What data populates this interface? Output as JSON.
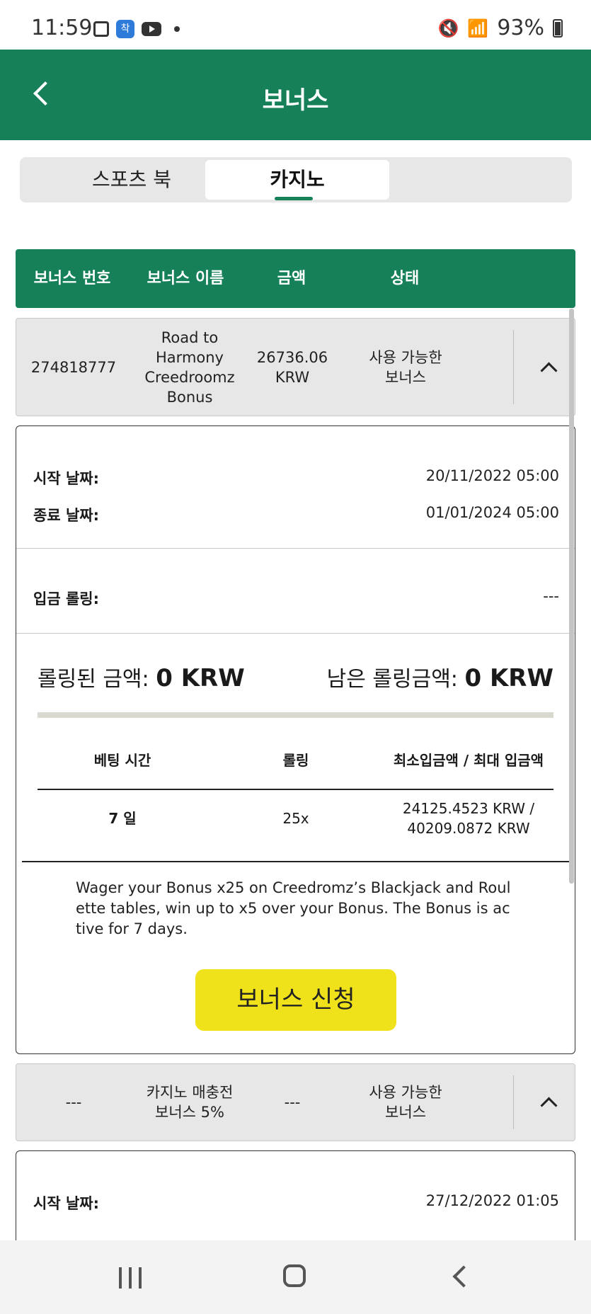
{
  "status_bar": {
    "time": "11:59",
    "notif_badge": "착",
    "battery_pct": "93%"
  },
  "header": {
    "title": "보너스"
  },
  "tabs": [
    {
      "label": "스포츠 북",
      "active": false
    },
    {
      "label": "카지노",
      "active": true
    }
  ],
  "table_headers": {
    "id": "보너스 번호",
    "name": "보너스 이름",
    "amount": "금액",
    "status": "상태"
  },
  "bonuses": [
    {
      "id": "274818777",
      "name": "Road to Harmony Creedroomz Bonus",
      "amount": "26736.06 KRW",
      "status": "사용 가능한 보너스",
      "details": {
        "start_label": "시작 날짜:",
        "start_value": "20/11/2022 05:00",
        "end_label": "종료 날짜:",
        "end_value": "01/01/2024 05:00",
        "deposit_rolling_label": "입금 롤링:",
        "deposit_rolling_value": "---",
        "rolled_label": "롤링된 금액:",
        "rolled_value": "0 KRW",
        "remaining_label": "남은 롤링금액:",
        "remaining_value": "0 KRW",
        "rolling_progress": 0,
        "table_headers": {
          "betting_time": "베팅 시간",
          "rolling": "롤링",
          "min_max": "최소입금액 / 최대 입금액"
        },
        "table_row": {
          "betting_time": "7 일",
          "rolling": "25x",
          "min_max": "24125.4523 KRW / 40209.0872 KRW"
        },
        "description": "Wager your Bonus x25 on Creedromz’s Blackjack and Roulette tables, win up to x5 over your Bonus. The Bonus is active for 7 days.",
        "apply_button": "보너스 신청"
      }
    },
    {
      "id": "---",
      "name": "카지노 매충전 보너스 5%",
      "amount": "---",
      "status": "사용 가능한 보너스",
      "details": {
        "start_label": "시작 날짜:",
        "start_value": "27/12/2022 01:05"
      }
    }
  ]
}
